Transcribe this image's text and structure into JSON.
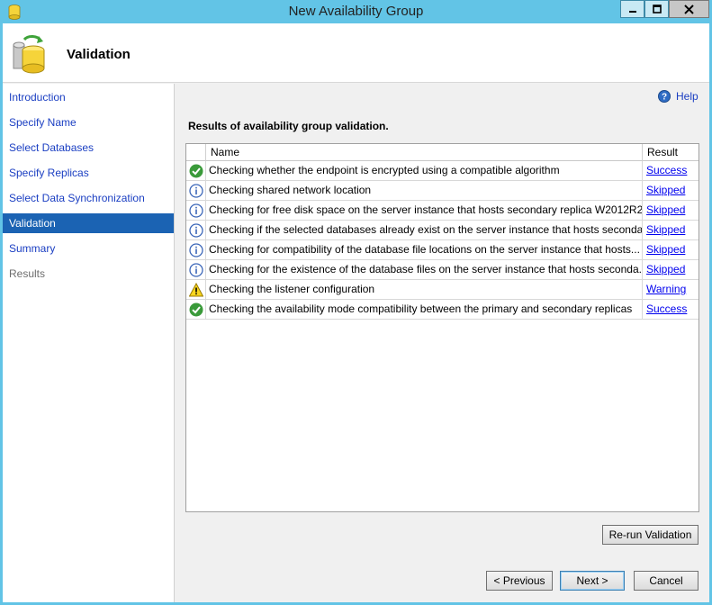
{
  "window": {
    "title": "New Availability Group"
  },
  "header": {
    "title": "Validation"
  },
  "sidebar": {
    "items": [
      {
        "label": "Introduction",
        "state": "link"
      },
      {
        "label": "Specify Name",
        "state": "link"
      },
      {
        "label": "Select Databases",
        "state": "link"
      },
      {
        "label": "Specify Replicas",
        "state": "link"
      },
      {
        "label": "Select Data Synchronization",
        "state": "link"
      },
      {
        "label": "Validation",
        "state": "active"
      },
      {
        "label": "Summary",
        "state": "link"
      },
      {
        "label": "Results",
        "state": "disabled"
      }
    ]
  },
  "content": {
    "help_label": "Help",
    "results_label": "Results of availability group validation.",
    "columns": {
      "name": "Name",
      "result": "Result"
    },
    "rows": [
      {
        "icon": "success-icon",
        "name": "Checking whether the endpoint is encrypted using a compatible algorithm",
        "result": "Success"
      },
      {
        "icon": "info-icon",
        "name": "Checking shared network location",
        "result": "Skipped"
      },
      {
        "icon": "info-icon",
        "name": "Checking for free disk space on the server instance that hosts secondary replica W2012R2...",
        "result": "Skipped"
      },
      {
        "icon": "info-icon",
        "name": "Checking if the selected databases already exist on the server instance that hosts seconda...",
        "result": "Skipped"
      },
      {
        "icon": "info-icon",
        "name": "Checking for compatibility of the database file locations on the server instance that hosts...",
        "result": "Skipped"
      },
      {
        "icon": "info-icon",
        "name": "Checking for the existence of the database files on the server instance that hosts seconda...",
        "result": "Skipped"
      },
      {
        "icon": "warning-icon",
        "name": "Checking the listener configuration",
        "result": "Warning"
      },
      {
        "icon": "success-icon",
        "name": "Checking the availability mode compatibility between the primary and secondary replicas",
        "result": "Success"
      }
    ],
    "rerun_label": "Re-run Validation"
  },
  "footer": {
    "previous_label": "< Previous",
    "next_label": "Next >",
    "cancel_label": "Cancel"
  },
  "colors": {
    "titlebar": "#62c4e6",
    "nav_active": "#1b63b3",
    "link": "#1a3ec2"
  }
}
